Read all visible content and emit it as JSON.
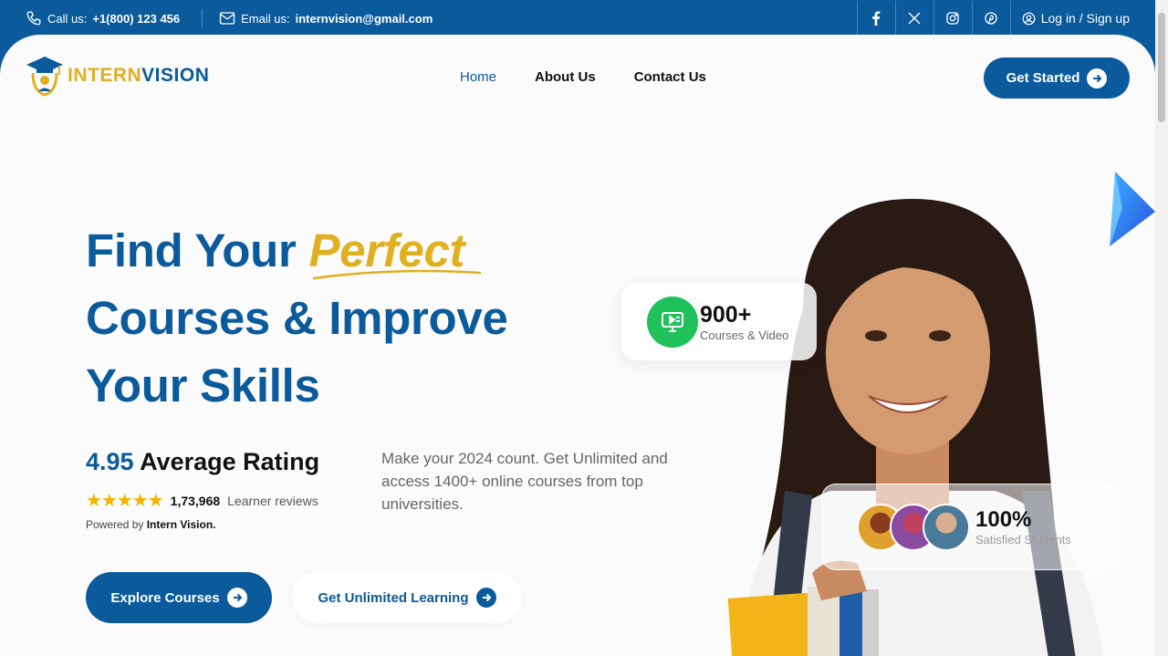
{
  "topbar": {
    "call_label": "Call us:",
    "call_value": "+1(800) 123 456",
    "email_label": "Email us:",
    "email_value": "internvision@gmail.com",
    "login": "Log in / Sign up",
    "social": [
      "facebook-icon",
      "x-icon",
      "instagram-icon",
      "pinterest-icon"
    ]
  },
  "header": {
    "logo_part1": "INTERN",
    "logo_part2": "VISION",
    "nav": [
      "Home",
      "About Us",
      "Contact Us"
    ],
    "cta": "Get Started"
  },
  "hero": {
    "title_line1_a": "Find Your ",
    "title_line1_b": "Perfect",
    "title_line2": "Courses & Improve",
    "title_line3": "Your Skills",
    "rating_value": "4.95",
    "rating_label": "Average Rating",
    "stars": "★★★★★",
    "reviews_count": "1,73,968",
    "reviews_label": "Learner reviews",
    "powered_label": "Powered by",
    "powered_brand": "Intern Vision.",
    "description": "Make your 2024 count. Get Unlimited and access 1400+ online courses from top universities.",
    "btn_explore": "Explore Courses",
    "btn_unlimited": "Get Unlimited Learning"
  },
  "cards": {
    "courses_value": "900+",
    "courses_label": "Courses & Video",
    "students_value": "100%",
    "students_label": "Satisfied Students"
  },
  "colors": {
    "primary": "#0a5a9c",
    "accent": "#e0b020",
    "green": "#1fc15b"
  }
}
